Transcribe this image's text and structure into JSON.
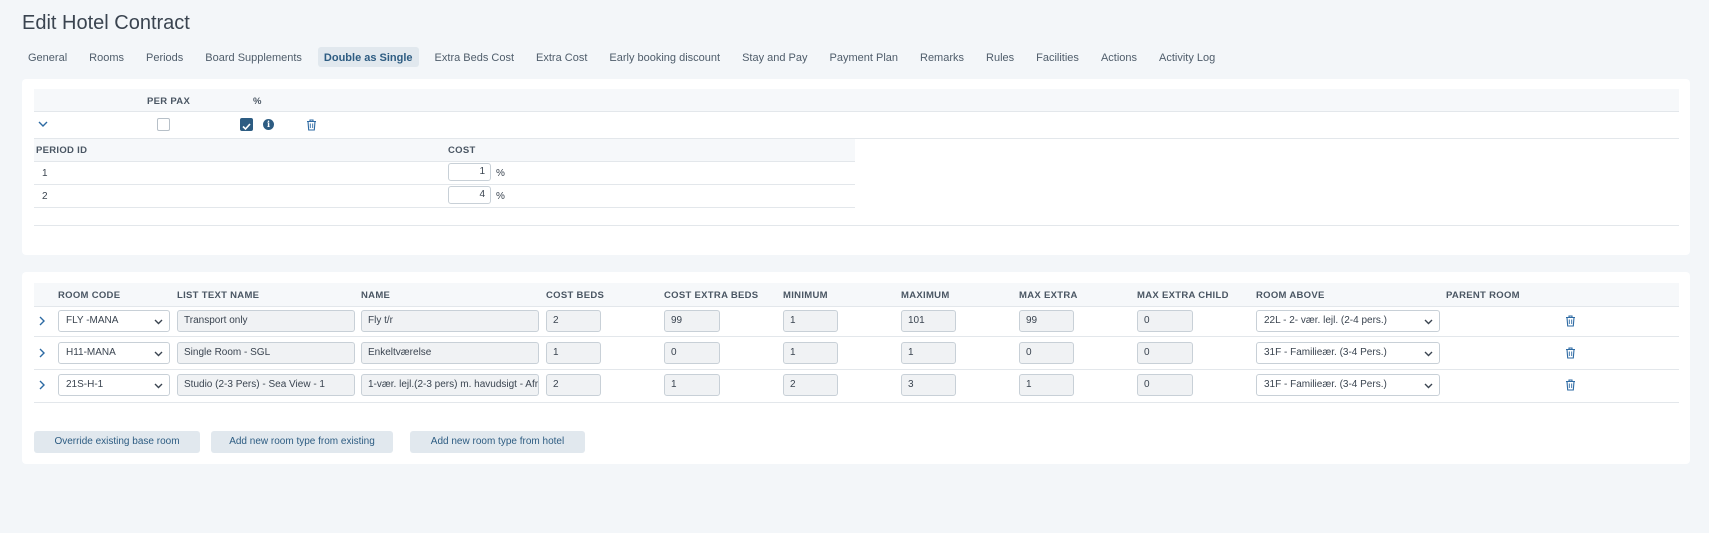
{
  "page": {
    "title": "Edit Hotel Contract"
  },
  "tabs": [
    {
      "label": "General"
    },
    {
      "label": "Rooms"
    },
    {
      "label": "Periods"
    },
    {
      "label": "Board Supplements"
    },
    {
      "label": "Double as Single",
      "active": true
    },
    {
      "label": "Extra Beds Cost"
    },
    {
      "label": "Extra Cost"
    },
    {
      "label": "Early booking discount"
    },
    {
      "label": "Stay and Pay"
    },
    {
      "label": "Payment Plan"
    },
    {
      "label": "Remarks"
    },
    {
      "label": "Rules"
    },
    {
      "label": "Facilities"
    },
    {
      "label": "Actions"
    },
    {
      "label": "Activity Log"
    }
  ],
  "double_as_single": {
    "headers": {
      "per_pax": "PER PAX",
      "percent": "%"
    },
    "per_pax_checked": false,
    "percent_checked": true,
    "info_icon": "i",
    "period_headers": {
      "period_id": "PERIOD ID",
      "cost": "COST"
    },
    "periods": [
      {
        "id": "1",
        "cost": "1",
        "unit": "%"
      },
      {
        "id": "2",
        "cost": "4",
        "unit": "%"
      }
    ]
  },
  "rooms": {
    "headers": {
      "room_code": "ROOM CODE",
      "list_text_name": "LIST TEXT NAME",
      "name": "NAME",
      "cost_beds": "COST BEDS",
      "cost_extra_beds": "COST EXTRA BEDS",
      "minimum": "MINIMUM",
      "maximum": "MAXIMUM",
      "max_extra": "MAX EXTRA",
      "max_extra_child": "MAX EXTRA CHILD",
      "room_above": "ROOM ABOVE",
      "parent_room": "PARENT ROOM"
    },
    "rows": [
      {
        "room_code": "FLY -MANA",
        "list_text_name": "Transport only",
        "name": "Fly t/r",
        "cost_beds": "2",
        "cost_extra_beds": "99",
        "minimum": "1",
        "maximum": "101",
        "max_extra": "99",
        "max_extra_child": "0",
        "room_above": "22L - 2- vær. lejl. (2-4 pers.)"
      },
      {
        "room_code": "H11-MANA",
        "list_text_name": "Single Room - SGL",
        "name": "Enkeltværelse",
        "cost_beds": "1",
        "cost_extra_beds": "0",
        "minimum": "1",
        "maximum": "1",
        "max_extra": "0",
        "max_extra_child": "0",
        "room_above": "31F - Familieær. (3-4 Pers.)"
      },
      {
        "room_code": "21S-H-1",
        "list_text_name": "Studio (2-3 Pers) - Sea View - 1",
        "name": "1-vær. lejl.(2-3 pers) m. havudsigt - Afr",
        "cost_beds": "2",
        "cost_extra_beds": "1",
        "minimum": "2",
        "maximum": "3",
        "max_extra": "1",
        "max_extra_child": "0",
        "room_above": "31F - Familieær. (3-4 Pers.)"
      }
    ],
    "buttons": {
      "override": "Override existing base room",
      "add_existing": "Add new room type from existing",
      "add_hotel": "Add new room type from hotel"
    }
  },
  "colors": {
    "accent": "#2d5c82",
    "background": "#f3f6f9",
    "card": "#ffffff",
    "tab_active_bg": "#e1e8ee"
  },
  "icons": [
    "chevron-down-icon",
    "chevron-right-icon",
    "check-icon",
    "info-icon",
    "trash-icon",
    "select-caret-icon"
  ]
}
